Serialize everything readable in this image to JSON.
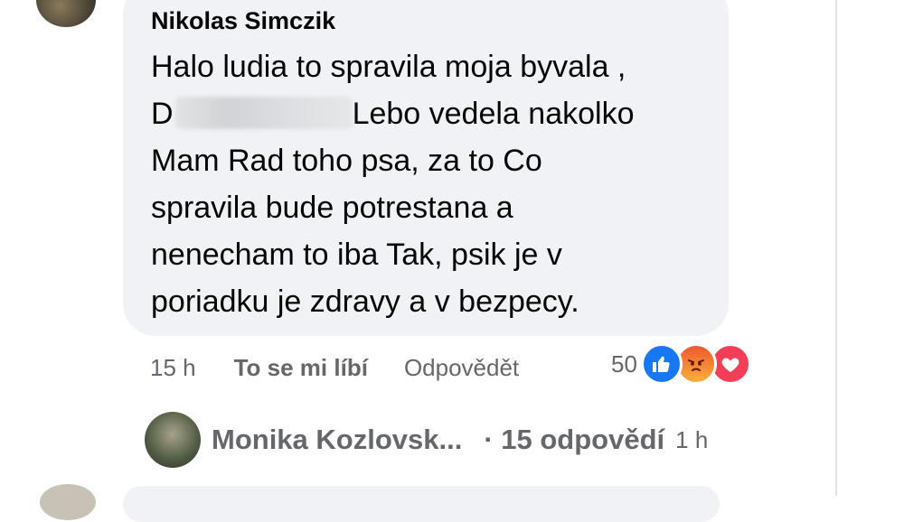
{
  "comment": {
    "author": "Nikolas Simczik",
    "lines": [
      "Halo ludia to spravila moja byvala ,",
      "D",
      "Lebo vedela nakolko",
      "Mam Rad toho psa, za to Co",
      "spravila bude potrestana a",
      "nenecham to iba Tak, psik je v",
      "poriadku je zdravy a v bezpecy."
    ],
    "time": "15 h",
    "like_label": "To se mi líbí",
    "reply_label": "Odpovědět",
    "reaction_count": "50",
    "reactions": [
      "like-icon",
      "angry-icon",
      "love-icon"
    ]
  },
  "reply_preview": {
    "name": "Monika Kozlovsk...",
    "replies": "· 15 odpovědí",
    "time": "1 h"
  },
  "colors": {
    "bubble": "#f0f2f5",
    "like": "#1877f2",
    "love": "#f33e58",
    "angry": "#f0572d"
  }
}
